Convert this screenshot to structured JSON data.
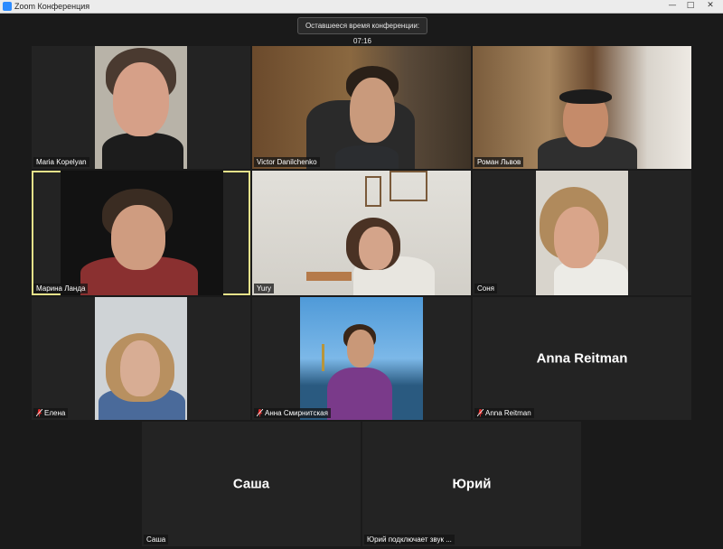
{
  "window": {
    "title": "Zoom Конференция",
    "controls": {
      "minimize": "—",
      "maximize": "□",
      "close": "✕"
    }
  },
  "meeting": {
    "time_remaining": "Оставшееся время конференции: 07:16"
  },
  "participants": [
    {
      "name": "Maria Kopelyan",
      "muted": false,
      "video": true,
      "active_speaker": false
    },
    {
      "name": "Victor Danilchenko",
      "muted": false,
      "video": true,
      "active_speaker": false
    },
    {
      "name": "Роман Львов",
      "muted": false,
      "video": true,
      "active_speaker": false
    },
    {
      "name": "Марина Ланда",
      "muted": false,
      "video": true,
      "active_speaker": true
    },
    {
      "name": "Yury",
      "muted": false,
      "video": true,
      "active_speaker": false
    },
    {
      "name": "Соня",
      "muted": false,
      "video": true,
      "active_speaker": false
    },
    {
      "name": "Елена",
      "muted": true,
      "video": true,
      "active_speaker": false
    },
    {
      "name": "Анна Смирнитская",
      "muted": true,
      "video": true,
      "active_speaker": false
    },
    {
      "name": "Anna Reitman",
      "display_name": "Anna Reitman",
      "muted": true,
      "video": false,
      "active_speaker": false
    },
    {
      "name": "Саша",
      "display_name": "Саша",
      "muted": false,
      "video": false,
      "active_speaker": false
    },
    {
      "name": "Юрий подключает звук ...",
      "display_name": "Юрий",
      "muted": false,
      "video": false,
      "active_speaker": false
    }
  ],
  "icons": {
    "muted_mic": "mic-muted-icon",
    "app": "zoom-app-icon"
  },
  "colors": {
    "active_speaker_border": "#e6e28a",
    "muted_mic": "#e02828",
    "background": "#1a1a1a",
    "tile": "#232323"
  }
}
